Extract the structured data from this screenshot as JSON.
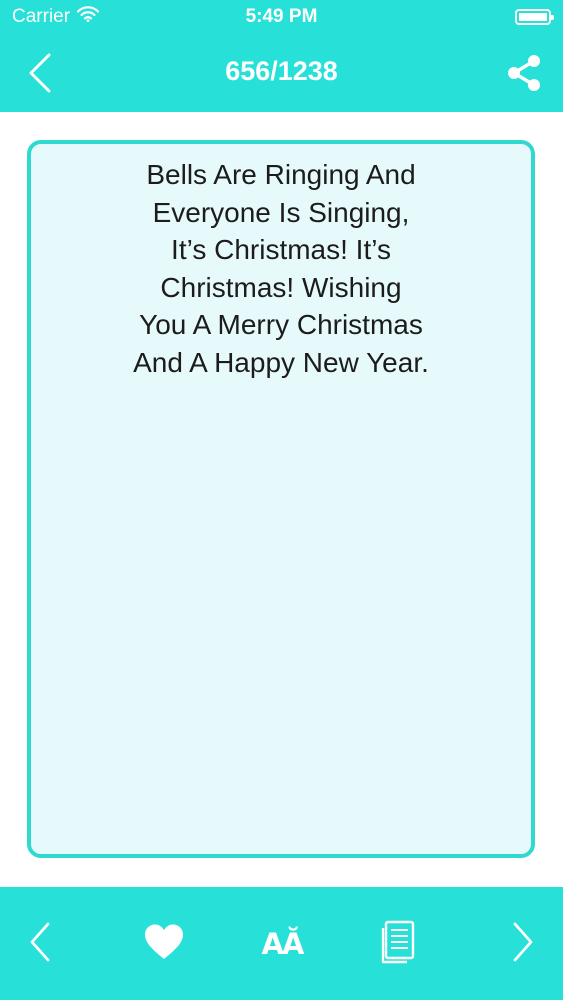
{
  "status_bar": {
    "carrier": "Carrier",
    "time": "5:49 PM",
    "wifi_icon": "wifi-icon",
    "battery_icon": "battery-icon"
  },
  "nav": {
    "title": "656/1238",
    "back_icon": "chevron-left-icon",
    "share_icon": "share-icon"
  },
  "quote": {
    "text": "Bells Are Ringing And\nEveryone Is Singing,\nIt’s Christmas! It’s\nChristmas! Wishing\nYou A Merry Christmas\nAnd A Happy New Year."
  },
  "toolbar": {
    "prev_icon": "chevron-left-icon",
    "favorite_icon": "heart-icon",
    "font_size_icon": "font-size-icon",
    "font_size_glyph": "AĂ",
    "copy_icon": "copy-document-icon",
    "next_icon": "chevron-right-icon"
  },
  "colors": {
    "accent": "#27e0d7",
    "card_border": "#2fd9d0",
    "card_background": "#e7fafb",
    "text": "#1c1c1c"
  }
}
